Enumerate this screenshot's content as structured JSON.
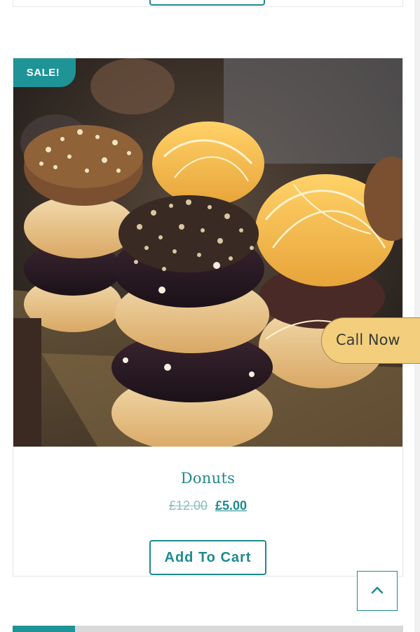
{
  "product": {
    "sale_badge": "SALE!",
    "title": "Donuts",
    "price_old": "£12.00",
    "price_new": "£5.00",
    "add_to_cart_label": "Add To Cart",
    "image_alt": "Stacked chocolate and glazed donuts"
  },
  "floating": {
    "call_now_label": "Call Now",
    "back_to_top_icon": "chevron-up-icon"
  },
  "colors": {
    "accent": "#1e8a8f",
    "sale_badge": "#1e9497",
    "call_now_bg": "#f3cf7d"
  }
}
